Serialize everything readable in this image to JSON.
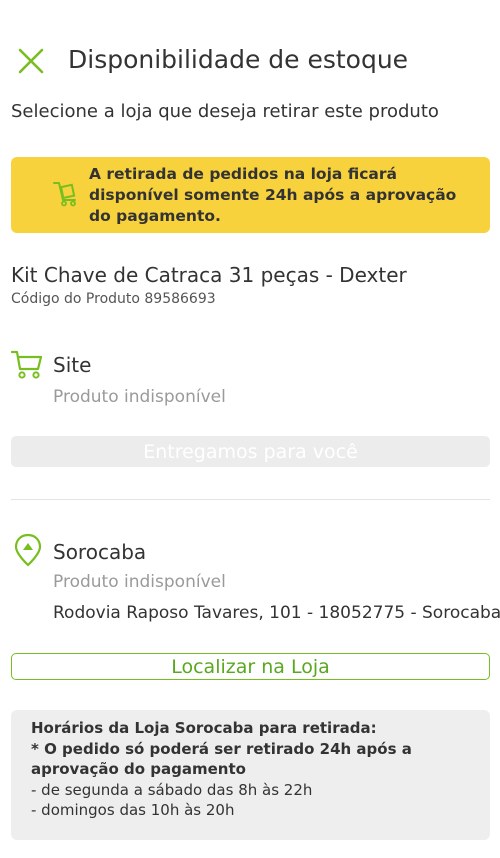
{
  "header": {
    "title": "Disponibilidade de estoque",
    "close_icon": "close-icon",
    "subtitle": "Selecione a loja que deseja retirar este produto"
  },
  "notice": {
    "icon": "pickup-cart-icon",
    "text": "A retirada de pedidos na loja ficará disponível somente 24h após a aprovação do pagamento."
  },
  "product": {
    "name": "Kit Chave de Catraca 31 peças - Dexter",
    "code_label": "Código do Produto 89586693"
  },
  "site": {
    "icon": "cart-icon",
    "label": "Site",
    "status": "Produto indisponível",
    "deliver_label": "Entregamos para você"
  },
  "store": {
    "icon": "location-pin-icon",
    "name": "Sorocaba",
    "status": "Produto indisponível",
    "address": "Rodovia Raposo Tavares, 101 - 18052775 - Sorocaba",
    "locate_label": "Localizar na Loja"
  },
  "hours": {
    "title": "Horários da Loja Sorocaba para retirada:",
    "note": "* O pedido só poderá ser retirado 24h após a aprovação do pagamento",
    "weekdays": "- de segunda a sábado das 8h às 22h",
    "sundays": "- domingos das 10h às 20h"
  },
  "colors": {
    "accent_green": "#78be20",
    "notice_yellow": "#f7d23c",
    "disabled_gray": "#ececec",
    "hours_bg": "#eeeeee"
  }
}
